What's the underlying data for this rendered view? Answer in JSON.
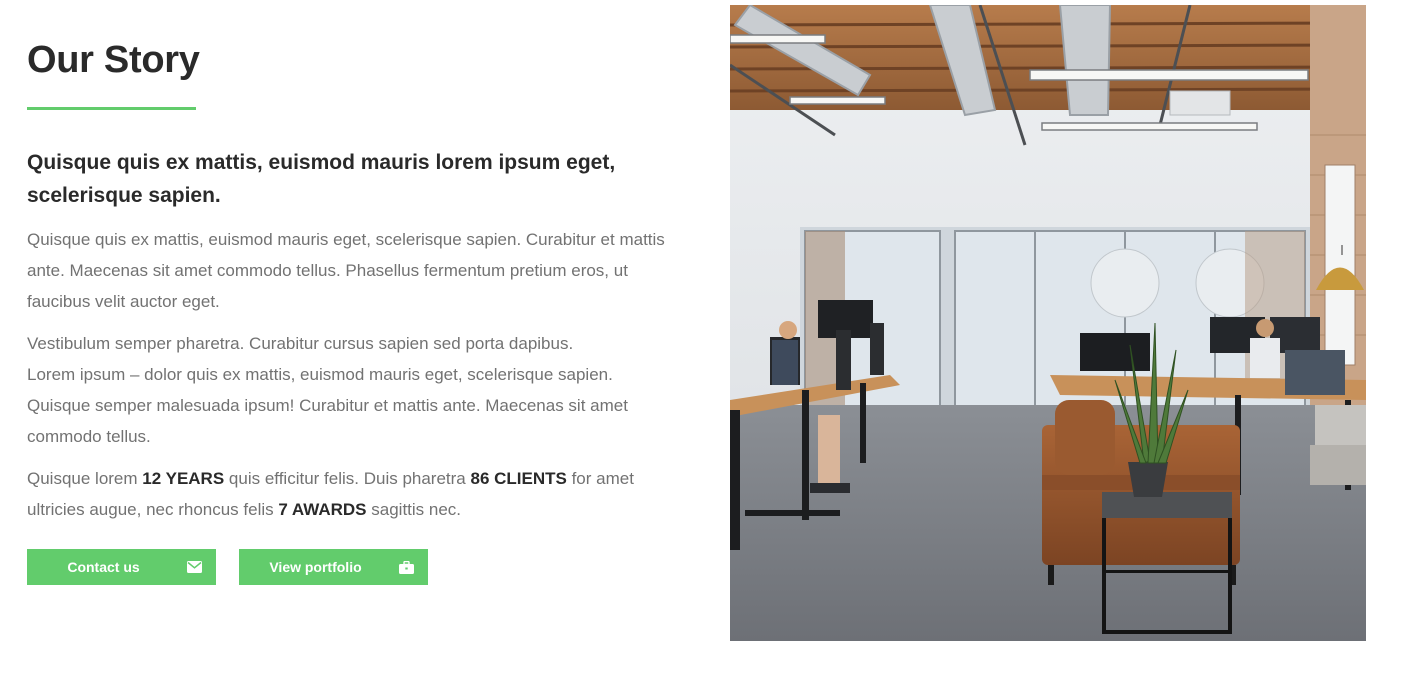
{
  "section": {
    "title": "Our Story",
    "accent_color": "#62cc6c",
    "subtitle": "Quisque quis ex mattis, euismod mauris lorem ipsum eget, scelerisque sapien.",
    "paragraph1": "Quisque quis ex mattis, euismod mauris eget, scelerisque sapien. Curabitur et mattis ante. Maecenas sit amet commodo tellus. Phasellus fermentum pretium eros, ut faucibus velit auctor eget.",
    "paragraph2_line1": "Vestibulum semper pharetra. Curabitur cursus sapien sed porta dapibus.",
    "paragraph2_line2": "Lorem ipsum – dolor quis ex mattis, euismod mauris eget, scelerisque sapien.",
    "paragraph2_line3": "Quisque semper malesuada ipsum! Curabitur et mattis ante. Maecenas sit amet commodo tellus.",
    "paragraph3": {
      "part1": "Quisque lorem ",
      "stat1": "12 YEARS",
      "part2": " quis efficitur felis. Duis pharetra ",
      "stat2": "86 CLIENTS",
      "part3": " for amet ultricies augue, nec rhoncus felis ",
      "stat3": "7 AWARDS",
      "part4": " sagittis nec."
    }
  },
  "buttons": {
    "contact_label": "Contact us",
    "contact_icon": "envelope-icon",
    "portfolio_label": "View portfolio",
    "portfolio_icon": "briefcase-icon"
  },
  "image": {
    "subject": "office-interior-photo"
  }
}
